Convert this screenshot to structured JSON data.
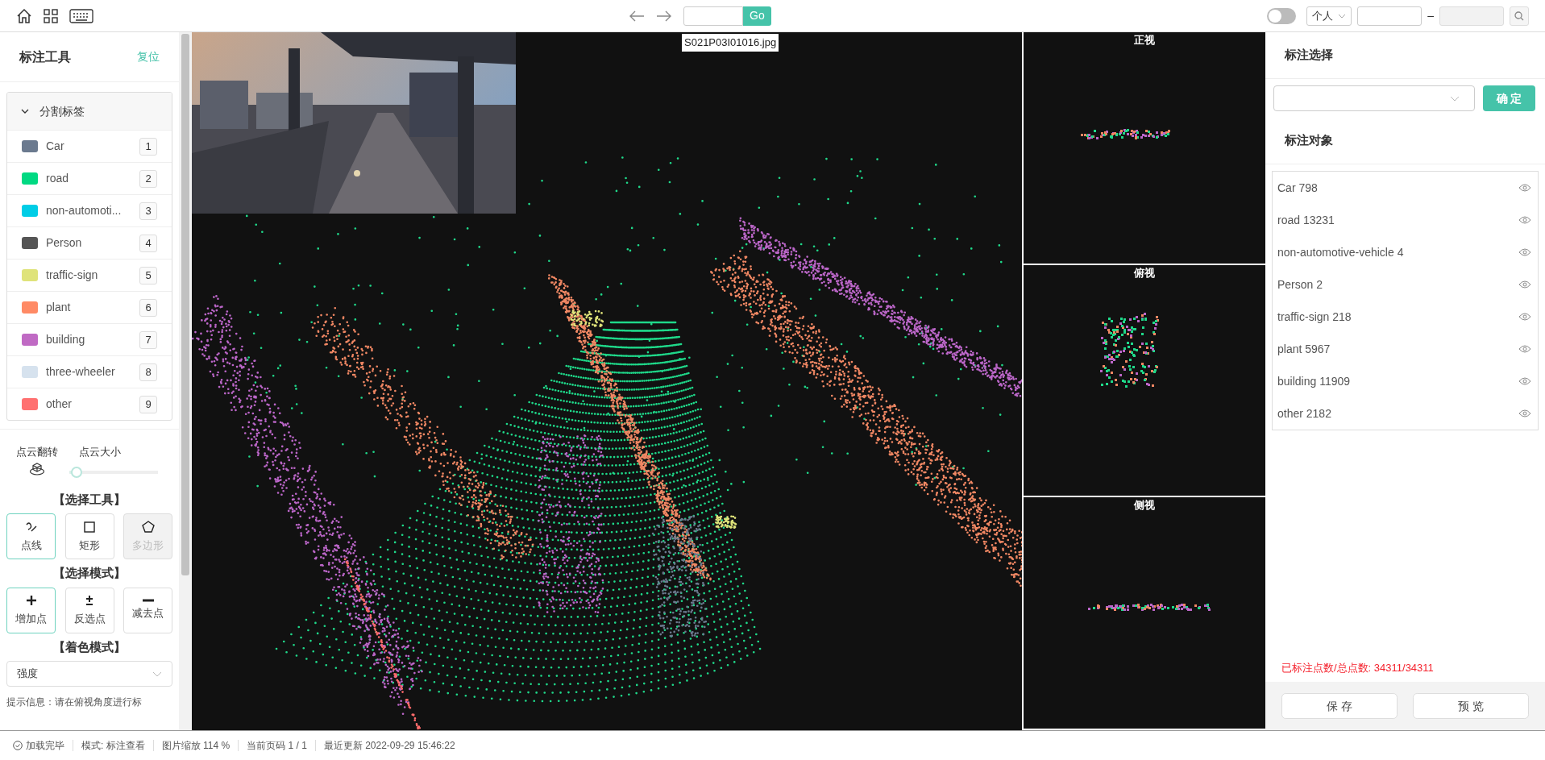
{
  "toolbar": {
    "go_button": "Go",
    "toggle": {
      "on": false
    },
    "scope": "个人",
    "date_separator": "–"
  },
  "left_panel": {
    "title": "标注工具",
    "reset_link": "复位",
    "label_group": {
      "title": "分割标签",
      "expanded": true,
      "labels": [
        {
          "name": "Car",
          "color": "#6b7a8f",
          "key": "1"
        },
        {
          "name": "road",
          "color": "#00d982",
          "key": "2"
        },
        {
          "name": "non-automoti...",
          "color": "#00cde6",
          "key": "3"
        },
        {
          "name": "Person",
          "color": "#555555",
          "key": "4"
        },
        {
          "name": "traffic-sign",
          "color": "#dfe37a",
          "key": "5"
        },
        {
          "name": "plant",
          "color": "#ff8a65",
          "key": "6"
        },
        {
          "name": "building",
          "color": "#c06ac4",
          "key": "7"
        },
        {
          "name": "three-wheeler",
          "color": "#d6e2ee",
          "key": "8"
        },
        {
          "name": "other",
          "color": "#ff7070",
          "key": "9"
        }
      ]
    },
    "flip_label": "点云翻转",
    "size_label": "点云大小",
    "size_slider": {
      "level": 0.08
    },
    "tool_title": "【选择工具】",
    "tools": [
      {
        "kind": "line",
        "label": "点线",
        "selected": true,
        "disabled": false
      },
      {
        "kind": "rect",
        "label": "矩形",
        "selected": false,
        "disabled": false
      },
      {
        "kind": "polygon",
        "label": "多边形",
        "selected": false,
        "disabled": true
      }
    ],
    "mode_title": "【选择模式】",
    "modes": [
      {
        "kind": "add",
        "label": "增加点",
        "selected": true
      },
      {
        "kind": "invert",
        "label": "反选点",
        "selected": false
      },
      {
        "kind": "subtract",
        "label": "减去点",
        "selected": false
      }
    ],
    "color_title": "【着色模式】",
    "color_mode": "强度",
    "hint": "提示信息：请在俯视角度进行标"
  },
  "canvas": {
    "image_name": "S021P03I01016.jpg"
  },
  "views": [
    {
      "kind": "front",
      "title": "正视"
    },
    {
      "kind": "top",
      "title": "俯视"
    },
    {
      "kind": "side",
      "title": "侧视"
    }
  ],
  "right_panel": {
    "selection_title": "标注选择",
    "confirm_button": "确 定",
    "objects_title": "标注对象",
    "objects": [
      {
        "text": "Car 798"
      },
      {
        "text": "road 13231"
      },
      {
        "text": "non-automotive-vehicle 4"
      },
      {
        "text": "Person 2"
      },
      {
        "text": "traffic-sign 218"
      },
      {
        "text": "plant 5967"
      },
      {
        "text": "building 11909"
      },
      {
        "text": "other 2182"
      }
    ],
    "count_text": "已标注点数/总点数: 34311/34311",
    "buttons": [
      "保 存",
      "预 览"
    ]
  },
  "status_bar": [
    {
      "kind": "check",
      "text": "加载完毕"
    },
    {
      "kind": "plain",
      "text": "模式: 标注查看"
    },
    {
      "kind": "plain",
      "text": "图片缩放 114 %"
    },
    {
      "kind": "plain",
      "text": "当前页码 1 / 1"
    },
    {
      "kind": "plain",
      "text": "最近更新 2022-09-29 15:46:22"
    }
  ]
}
